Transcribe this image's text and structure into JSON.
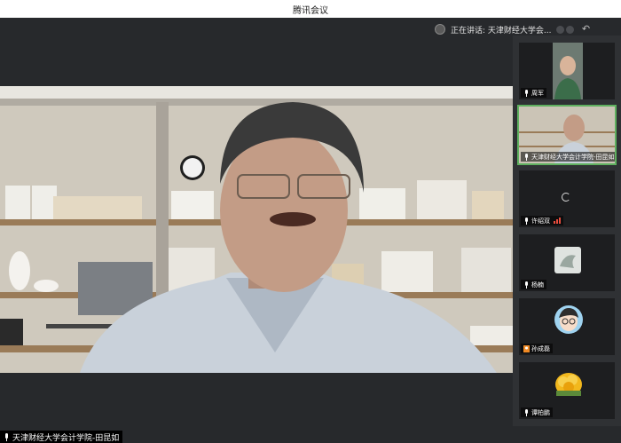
{
  "app": {
    "title": "腾讯会议"
  },
  "speaking": {
    "text": "正在讲话: 天津财经大学会..."
  },
  "main_video": {
    "name": "天津财经大学会计学院-田昆如"
  },
  "participants": [
    {
      "name": "周军",
      "type": "video"
    },
    {
      "name": "天津财经大学会计学院-田昆如",
      "type": "video",
      "active": true
    },
    {
      "name": "许绍双",
      "type": "loading"
    },
    {
      "name": "杨楠",
      "type": "avatar-image"
    },
    {
      "name": "孙成磊",
      "type": "avatar-cartoon"
    },
    {
      "name": "谭柏鹏",
      "type": "avatar-flower"
    }
  ],
  "colors": {
    "active_border": "#5fb05f",
    "signal": "#e94c3d",
    "background": "#27292c"
  }
}
